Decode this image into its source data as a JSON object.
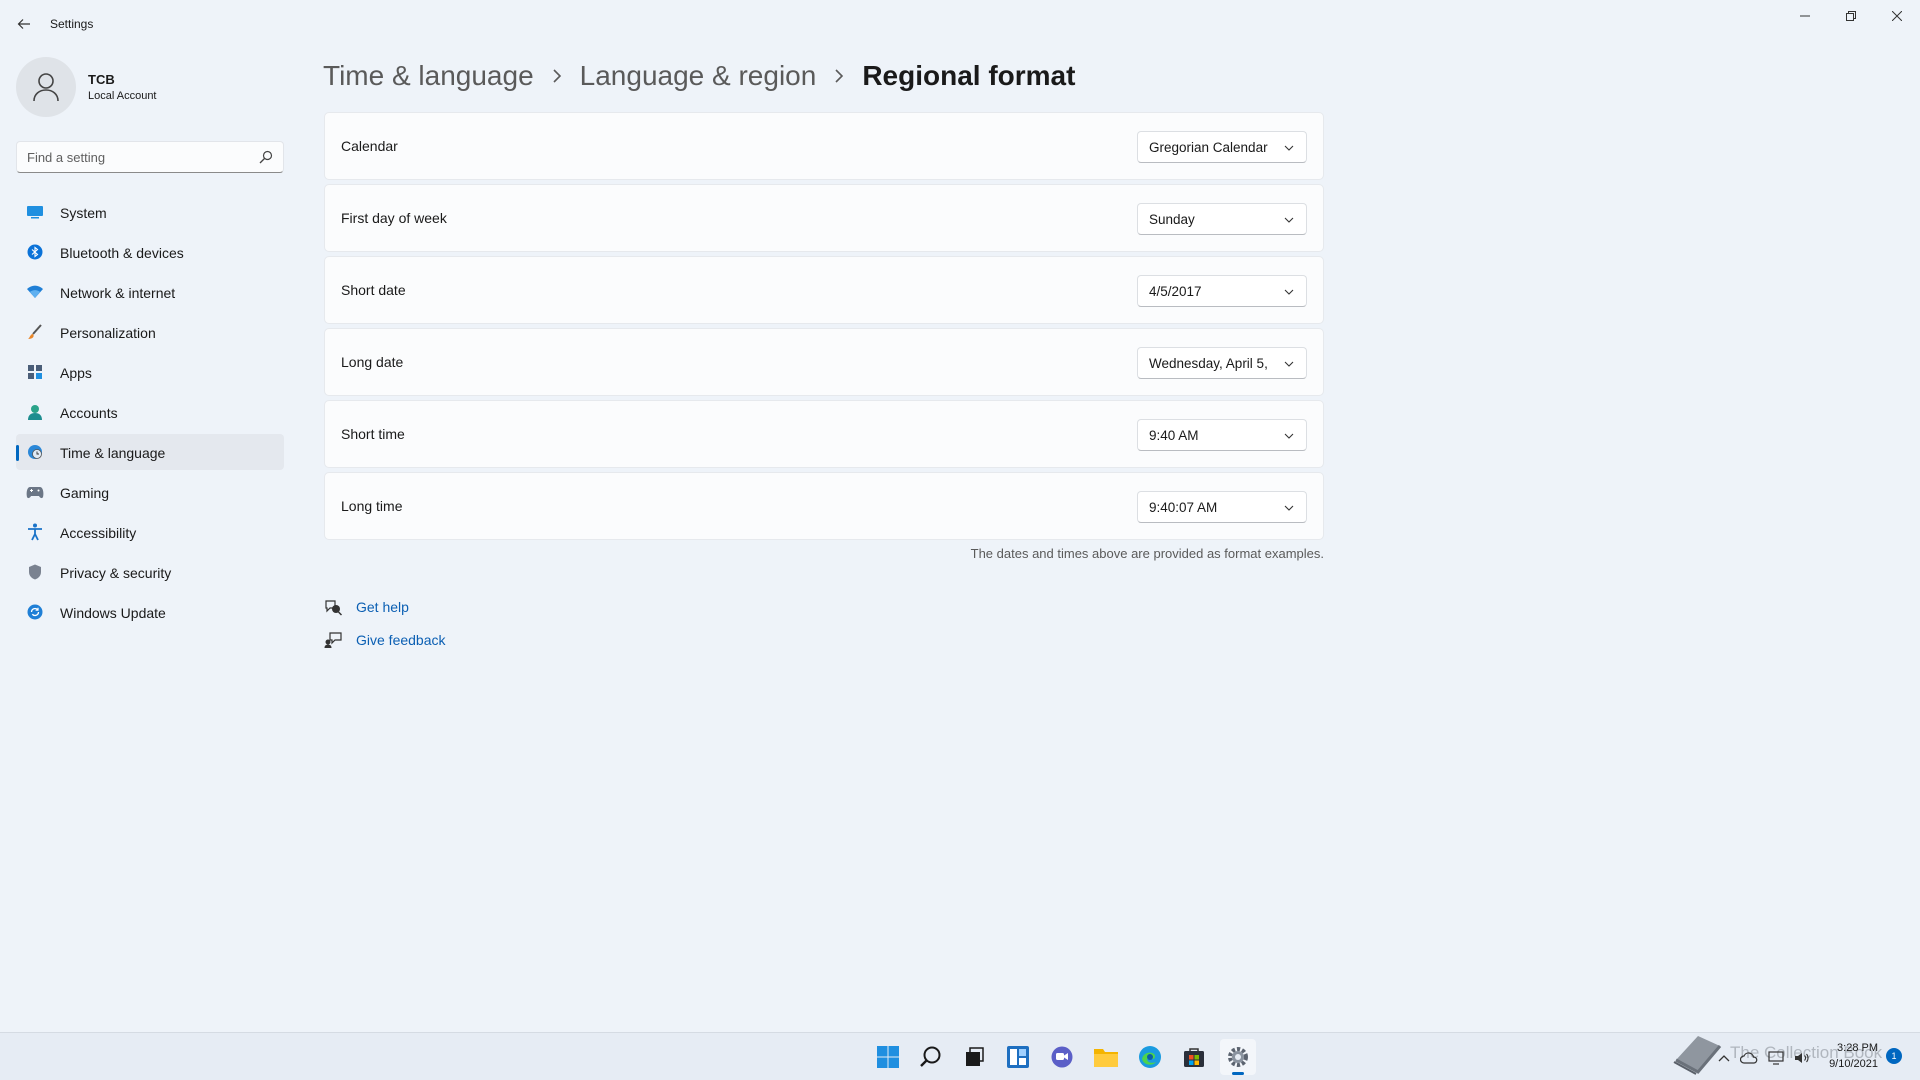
{
  "window": {
    "title": "Settings"
  },
  "profile": {
    "name": "TCB",
    "account_type": "Local Account"
  },
  "search": {
    "placeholder": "Find a setting"
  },
  "sidebar": {
    "items": [
      {
        "label": "System",
        "icon": "system-icon"
      },
      {
        "label": "Bluetooth & devices",
        "icon": "bluetooth-icon"
      },
      {
        "label": "Network & internet",
        "icon": "wifi-icon"
      },
      {
        "label": "Personalization",
        "icon": "brush-icon"
      },
      {
        "label": "Apps",
        "icon": "apps-icon"
      },
      {
        "label": "Accounts",
        "icon": "person-icon"
      },
      {
        "label": "Time & language",
        "icon": "globe-clock-icon",
        "selected": true
      },
      {
        "label": "Gaming",
        "icon": "gamepad-icon"
      },
      {
        "label": "Accessibility",
        "icon": "accessibility-icon"
      },
      {
        "label": "Privacy & security",
        "icon": "shield-icon"
      },
      {
        "label": "Windows Update",
        "icon": "update-icon"
      }
    ]
  },
  "breadcrumb": {
    "level1": "Time & language",
    "level2": "Language & region",
    "current": "Regional format"
  },
  "settings": [
    {
      "label": "Calendar",
      "value": "Gregorian Calendar"
    },
    {
      "label": "First day of week",
      "value": "Sunday"
    },
    {
      "label": "Short date",
      "value": "4/5/2017"
    },
    {
      "label": "Long date",
      "value": "Wednesday, April 5,"
    },
    {
      "label": "Short time",
      "value": "9:40 AM"
    },
    {
      "label": "Long time",
      "value": "9:40:07 AM"
    }
  ],
  "note": "The dates and times above are provided as format examples.",
  "help": {
    "get_help": "Get help",
    "give_feedback": "Give feedback"
  },
  "taskbar": {
    "apps": [
      "start-icon",
      "search-icon",
      "task-view-icon",
      "widgets-icon",
      "chat-icon",
      "file-explorer-icon",
      "edge-icon",
      "store-icon",
      "settings-icon"
    ],
    "clock_time": "3:28 PM",
    "clock_date": "9/10/2021",
    "notification_count": "1",
    "watermark": "The Collection Book"
  },
  "colors": {
    "accent": "#0067c0",
    "background": "#eef3f9",
    "card": "#fbfcfd",
    "link": "#0b5fb3"
  }
}
